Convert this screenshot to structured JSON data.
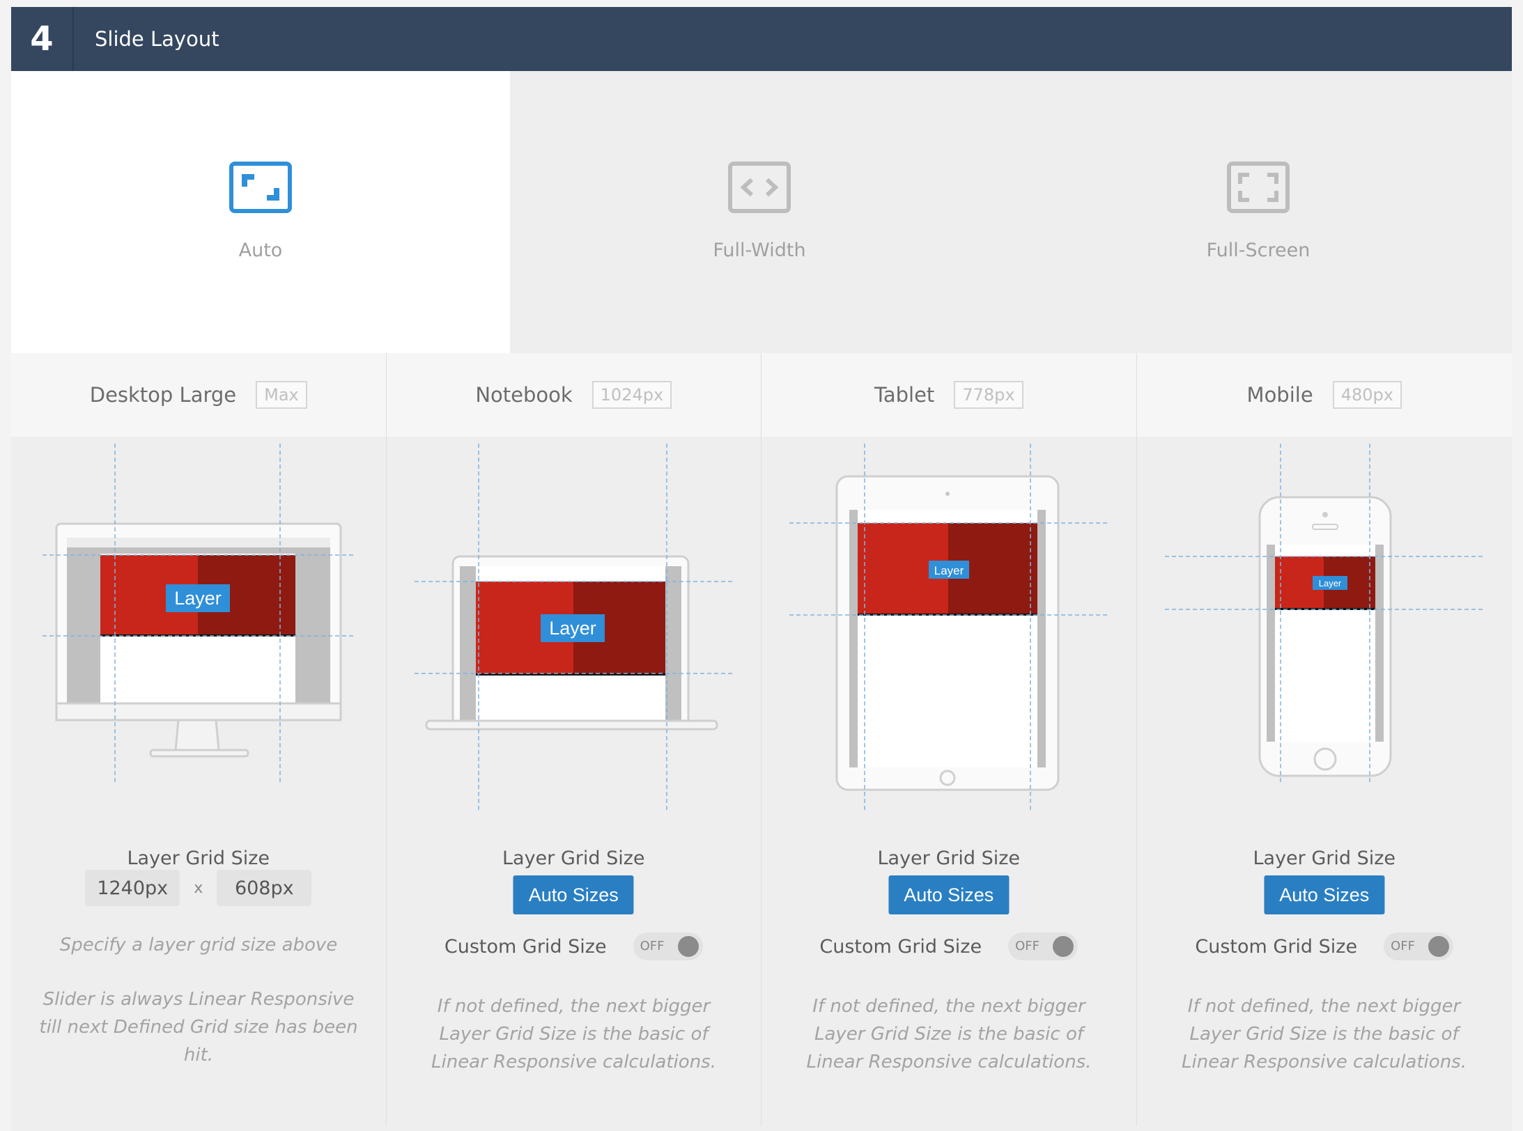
{
  "header": {
    "step": "4",
    "title": "Slide Layout"
  },
  "layout_options": [
    {
      "label": "Auto",
      "icon": "auto-layout-icon",
      "active": true
    },
    {
      "label": "Full-Width",
      "icon": "full-width-icon",
      "active": false
    },
    {
      "label": "Full-Screen",
      "icon": "full-screen-icon",
      "active": false
    }
  ],
  "devices": [
    {
      "name": "Desktop Large",
      "tag": "Max",
      "layer": "Layer",
      "grid_label": "Layer Grid Size",
      "width_value": "1240px",
      "height_value": "608px",
      "x": "x",
      "note1": "Specify a layer grid size above",
      "note2": "Slider is always Linear Responsive till next Defined Grid size has been hit."
    },
    {
      "name": "Notebook",
      "tag": "1024px",
      "layer": "Layer",
      "grid_label": "Layer Grid Size",
      "auto_label": "Auto Sizes",
      "custom_label": "Custom Grid Size",
      "toggle": "OFF",
      "note": "If not defined, the next bigger Layer Grid Size is the basic of Linear Responsive calculations."
    },
    {
      "name": "Tablet",
      "tag": "778px",
      "layer": "Layer",
      "grid_label": "Layer Grid Size",
      "auto_label": "Auto Sizes",
      "custom_label": "Custom Grid Size",
      "toggle": "OFF",
      "note": "If not defined, the next bigger Layer Grid Size is the basic of Linear Responsive calculations."
    },
    {
      "name": "Mobile",
      "tag": "480px",
      "layer": "Layer",
      "grid_label": "Layer Grid Size",
      "auto_label": "Auto Sizes",
      "custom_label": "Custom Grid Size",
      "toggle": "OFF",
      "note": "If not defined, the next bigger Layer Grid Size is the basic of Linear Responsive calculations."
    }
  ],
  "colors": {
    "header": "#35475f",
    "accent": "#2a7fc3",
    "slide_red": "#c8261a"
  }
}
